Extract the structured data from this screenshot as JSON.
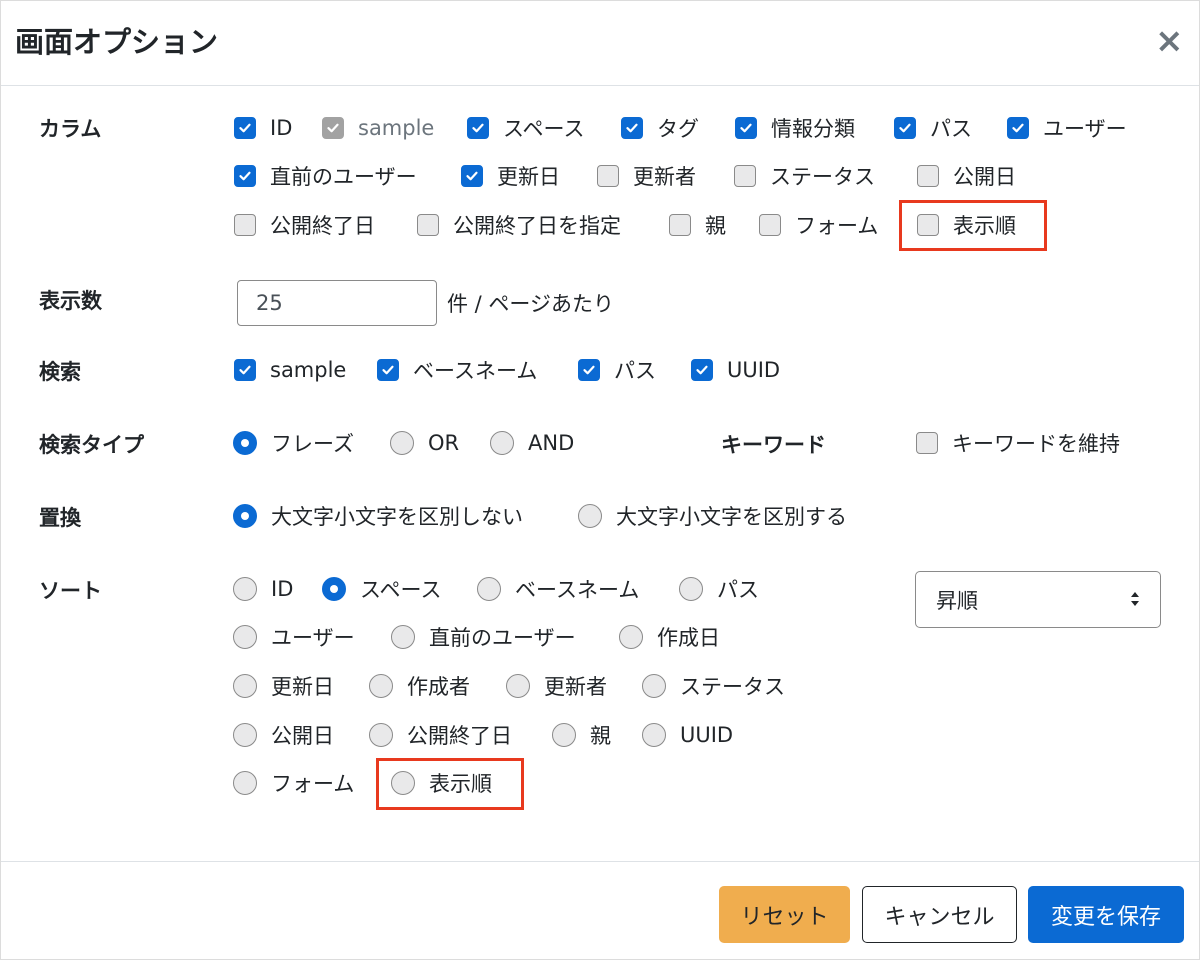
{
  "dialog": {
    "title": "画面オプション",
    "close_symbol": "×"
  },
  "columns": {
    "label": "カラム",
    "items": [
      {
        "label": "ID",
        "state": "checked"
      },
      {
        "label": "sample",
        "state": "disabled-checked"
      },
      {
        "label": "スペース",
        "state": "checked"
      },
      {
        "label": "タグ",
        "state": "checked"
      },
      {
        "label": "情報分類",
        "state": "checked"
      },
      {
        "label": "パス",
        "state": "checked"
      },
      {
        "label": "ユーザー",
        "state": "checked"
      },
      {
        "label": "直前のユーザー",
        "state": "checked"
      },
      {
        "label": "更新日",
        "state": "checked"
      },
      {
        "label": "更新者",
        "state": "unchecked"
      },
      {
        "label": "ステータス",
        "state": "unchecked"
      },
      {
        "label": "公開日",
        "state": "unchecked"
      },
      {
        "label": "公開終了日",
        "state": "unchecked"
      },
      {
        "label": "公開終了日を指定",
        "state": "unchecked"
      },
      {
        "label": "親",
        "state": "unchecked"
      },
      {
        "label": "フォーム",
        "state": "unchecked"
      },
      {
        "label": "表示順",
        "state": "unchecked"
      }
    ]
  },
  "display_count": {
    "label": "表示数",
    "value": "25",
    "suffix": "件 / ページあたり"
  },
  "search": {
    "label": "検索",
    "items": [
      {
        "label": "sample",
        "state": "checked"
      },
      {
        "label": "ベースネーム",
        "state": "checked"
      },
      {
        "label": "パス",
        "state": "checked"
      },
      {
        "label": "UUID",
        "state": "checked"
      }
    ]
  },
  "search_type": {
    "label": "検索タイプ",
    "options": [
      {
        "label": "フレーズ",
        "selected": true
      },
      {
        "label": "OR",
        "selected": false
      },
      {
        "label": "AND",
        "selected": false
      }
    ],
    "keyword_label": "キーワード",
    "keyword_option": {
      "label": "キーワードを維持",
      "state": "unchecked"
    }
  },
  "replace": {
    "label": "置換",
    "options": [
      {
        "label": "大文字小文字を区別しない",
        "selected": true
      },
      {
        "label": "大文字小文字を区別する",
        "selected": false
      }
    ]
  },
  "sort": {
    "label": "ソート",
    "options": [
      {
        "label": "ID",
        "selected": false
      },
      {
        "label": "スペース",
        "selected": true
      },
      {
        "label": "ベースネーム",
        "selected": false
      },
      {
        "label": "パス",
        "selected": false
      },
      {
        "label": "ユーザー",
        "selected": false
      },
      {
        "label": "直前のユーザー",
        "selected": false
      },
      {
        "label": "作成日",
        "selected": false
      },
      {
        "label": "更新日",
        "selected": false
      },
      {
        "label": "作成者",
        "selected": false
      },
      {
        "label": "更新者",
        "selected": false
      },
      {
        "label": "ステータス",
        "selected": false
      },
      {
        "label": "公開日",
        "selected": false
      },
      {
        "label": "公開終了日",
        "selected": false
      },
      {
        "label": "親",
        "selected": false
      },
      {
        "label": "UUID",
        "selected": false
      },
      {
        "label": "フォーム",
        "selected": false
      },
      {
        "label": "表示順",
        "selected": false
      }
    ],
    "order_select": "昇順"
  },
  "footer": {
    "reset": "リセット",
    "cancel": "キャンセル",
    "save": "変更を保存"
  },
  "colors": {
    "accent": "#0b6ad3",
    "warning": "#f0ad4e",
    "highlight": "#e8391e"
  }
}
